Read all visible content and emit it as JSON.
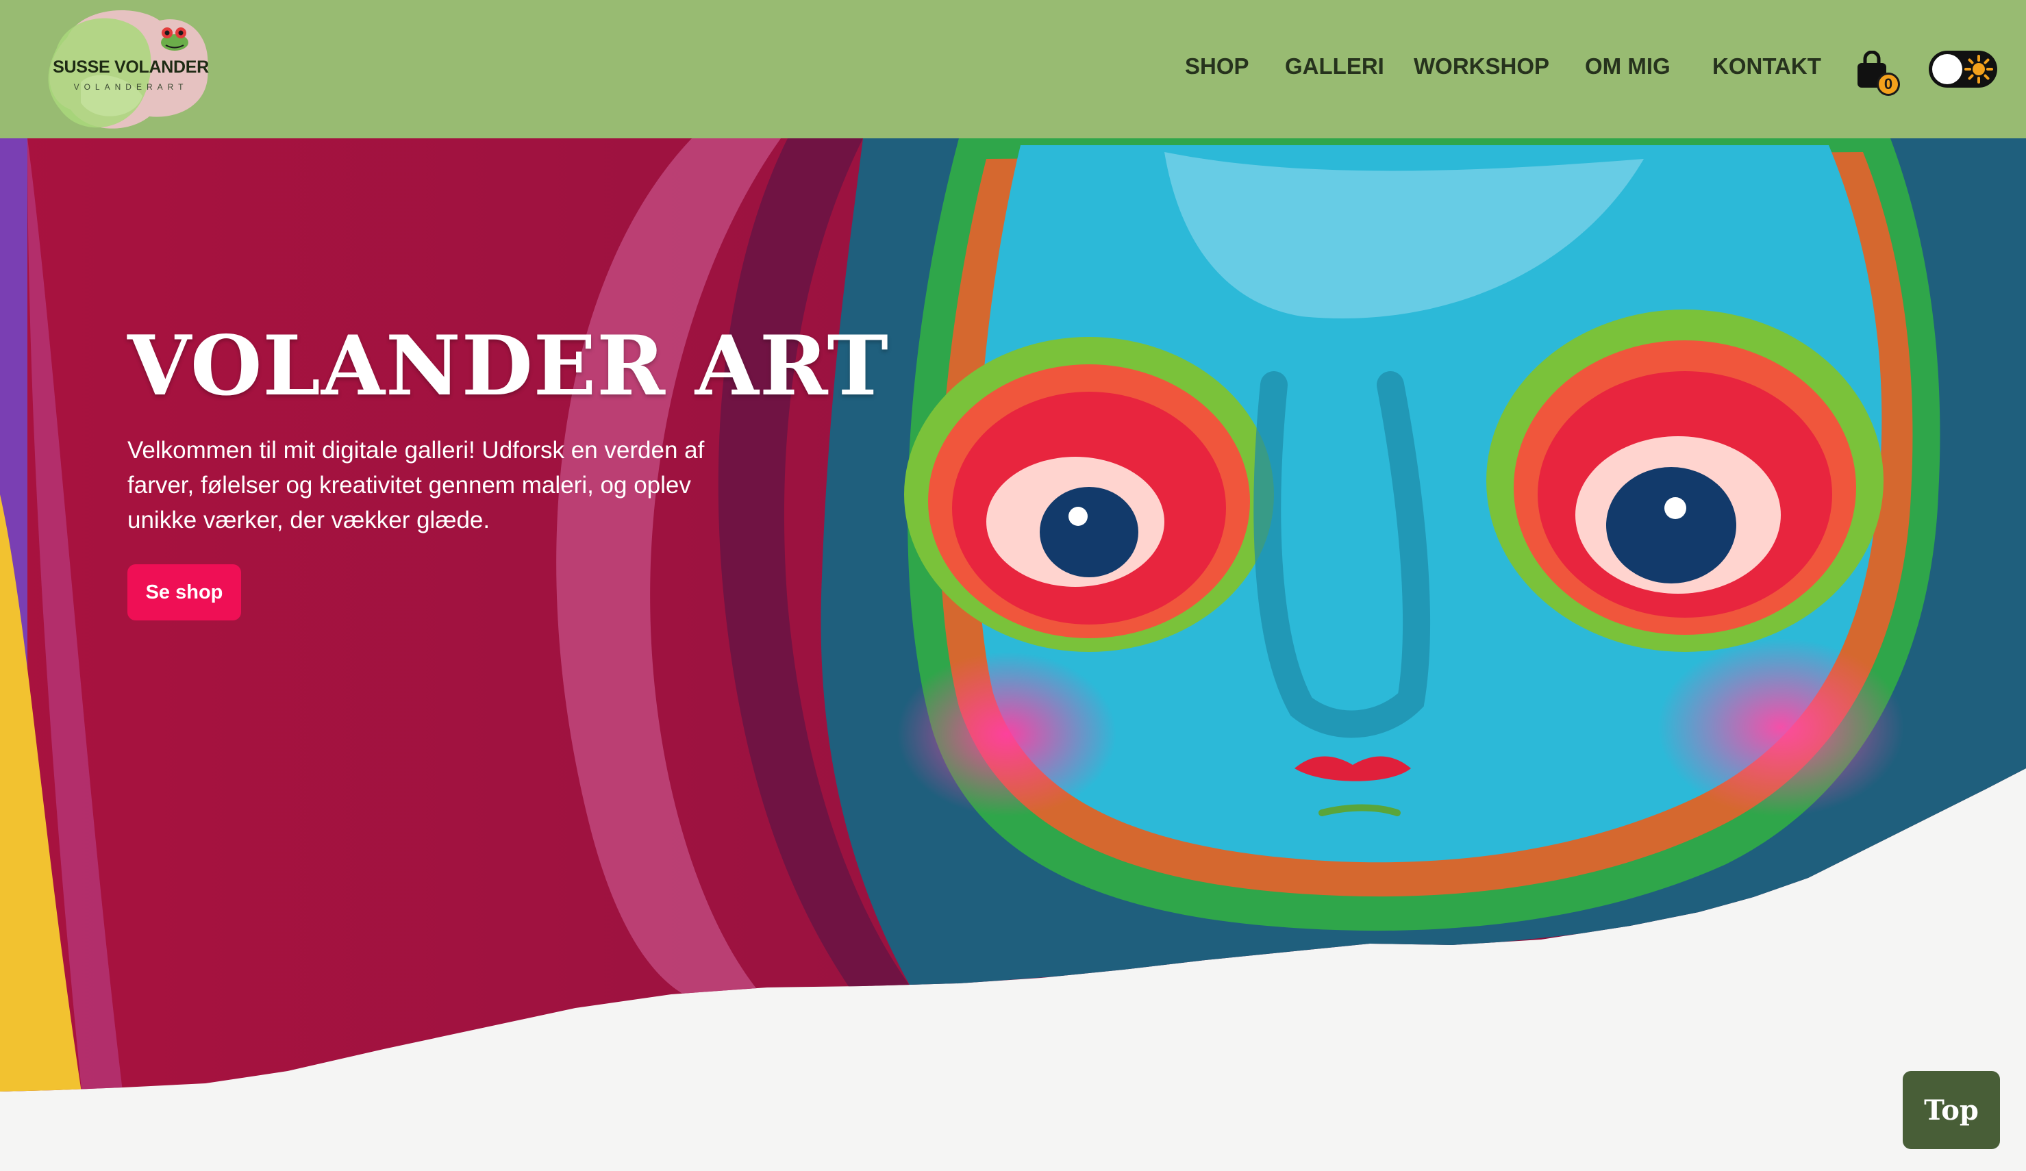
{
  "brand": {
    "name": "SUSSE VOLANDER",
    "subtitle": "VOLANDERART"
  },
  "nav": {
    "items": [
      {
        "label": "SHOP"
      },
      {
        "label": "GALLERI"
      },
      {
        "label": "WORKSHOP"
      },
      {
        "label": "OM MIG"
      },
      {
        "label": "KONTAKT"
      }
    ]
  },
  "cart": {
    "count": "0",
    "icon": "shopping-bag-icon"
  },
  "theme_toggle": {
    "icon": "sun-icon",
    "state": "light"
  },
  "hero": {
    "title": "VOLANDER ART",
    "text": "Velkommen til mit digitale galleri! Udforsk en verden af farver, følelser og kreativitet gennem maleri, og oplev unikke værker, der vækker glæde.",
    "button_label": "Se shop"
  },
  "top_button": {
    "label": "Top"
  },
  "colors": {
    "header_bg": "#98bb72",
    "nav_text": "#26321d",
    "accent_button": "#ef0f55",
    "top_button_bg": "#485e37",
    "cart_badge": "#f4a11c",
    "page_bg": "#f5f5f4"
  }
}
